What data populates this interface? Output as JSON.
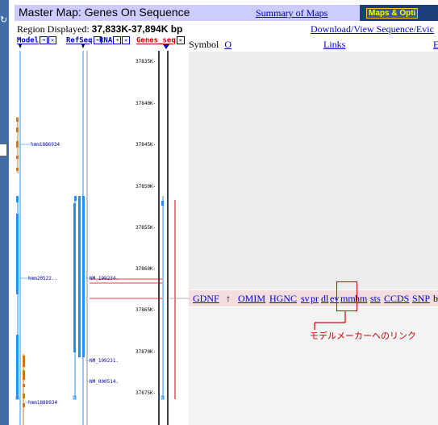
{
  "header": {
    "title": "Master Map: Genes On Sequence",
    "summary_link": "Summary of Maps",
    "maps_button": "Maps & Opti"
  },
  "region": {
    "label": "Region Displayed:",
    "value": "37,833K-37,894K bp"
  },
  "download_link": "Download/View Sequence/Evic",
  "maps": {
    "model": "Model",
    "refseq": "RefSeq",
    "rna": "RNA",
    "genes_seq": "Genes_seq"
  },
  "symbol_header": {
    "label": "Symbol",
    "sort": "O",
    "links": "Links",
    "extra": "E"
  },
  "gene_row": {
    "symbol": "GDNF",
    "arrow": "↑",
    "links": [
      "OMIM",
      "HGNC",
      "sv",
      "pr",
      "dl",
      "ev",
      "mm",
      "hm",
      "sts",
      "CCDS",
      "SNP"
    ],
    "trailing": "b"
  },
  "annotation": {
    "text": "モデルメーカーへのリンク"
  },
  "track_labels": {
    "hmm1": "hmm1886934",
    "hmm2": "hmm20522..",
    "hmm3": "hmm1888934",
    "nm1": "NM_199234.",
    "nm2": "NM_199231.",
    "nm3": "NM_000514."
  },
  "ticks": [
    "37835K-",
    "37840K-",
    "37845K-",
    "37850K-",
    "37855K-",
    "37860K-",
    "37865K-",
    "37870K-",
    "37875K-"
  ],
  "colors": {
    "header_bg": "#ccccff",
    "link": "#0000cc",
    "genes_seq": "#cc0000",
    "model_exon": "#cc7722",
    "refseq_exon": "#1e90ff",
    "highlight": "#d00000"
  }
}
